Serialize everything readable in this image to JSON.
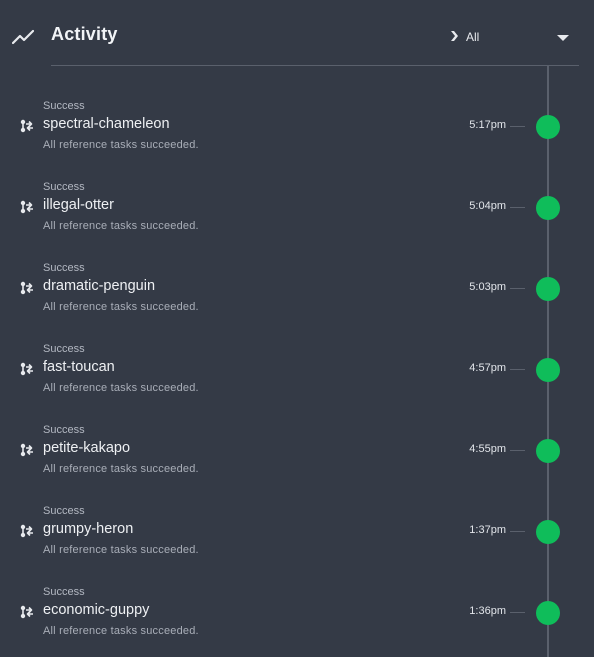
{
  "header": {
    "title": "Activity",
    "icon": "trending-up-icon",
    "filter": {
      "label": "All",
      "icon": "chevron-right-icon",
      "caret": "caret-down-icon"
    }
  },
  "colors": {
    "success": "#0fbd5a",
    "background": "#343a46",
    "line": "#5a606c"
  },
  "items": [
    {
      "status": "Success",
      "name": "spectral-chameleon",
      "description": "All reference tasks succeeded.",
      "time": "5:17pm"
    },
    {
      "status": "Success",
      "name": "illegal-otter",
      "description": "All reference tasks succeeded.",
      "time": "5:04pm"
    },
    {
      "status": "Success",
      "name": "dramatic-penguin",
      "description": "All reference tasks succeeded.",
      "time": "5:03pm"
    },
    {
      "status": "Success",
      "name": "fast-toucan",
      "description": "All reference tasks succeeded.",
      "time": "4:57pm"
    },
    {
      "status": "Success",
      "name": "petite-kakapo",
      "description": "All reference tasks succeeded.",
      "time": "4:55pm"
    },
    {
      "status": "Success",
      "name": "grumpy-heron",
      "description": "All reference tasks succeeded.",
      "time": "1:37pm"
    },
    {
      "status": "Success",
      "name": "economic-guppy",
      "description": "All reference tasks succeeded.",
      "time": "1:36pm"
    }
  ]
}
